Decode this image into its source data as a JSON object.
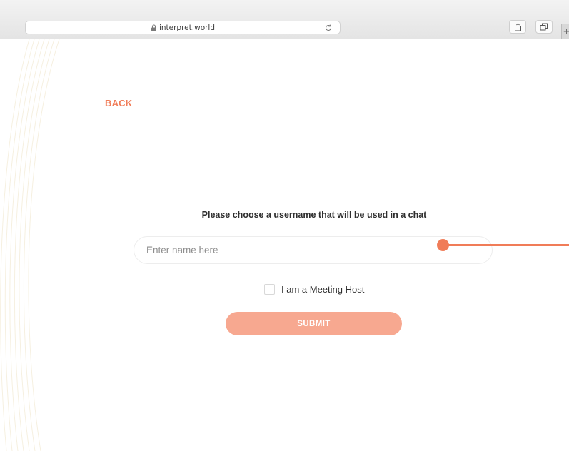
{
  "browser": {
    "url": "interpret.world",
    "new_tab_label": "+"
  },
  "page": {
    "back_label": "BACK",
    "prompt": "Please choose a username that will be used in a chat",
    "name_input": {
      "value": "",
      "placeholder": "Enter name here"
    },
    "host_checkbox": {
      "label": "I am a Meeting Host",
      "checked": false
    },
    "submit_label": "SUBMIT"
  },
  "colors": {
    "accent": "#f07c58",
    "button": "#f7a890",
    "chrome": "#e9e9e9"
  },
  "icons": [
    "lock-icon",
    "reload-icon",
    "share-icon",
    "tabs-icon"
  ]
}
